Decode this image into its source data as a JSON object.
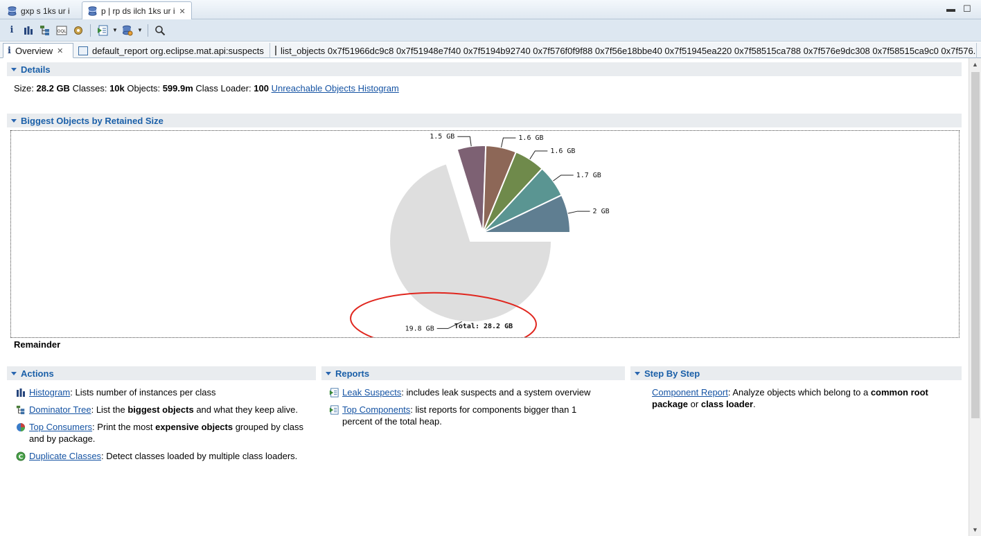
{
  "editor_tabs": [
    {
      "label": "gxp s 1ks ur i"
    },
    {
      "label": "p | rp ds ilch 1ks ur i"
    }
  ],
  "inner_tabs": {
    "overview": "Overview",
    "report": "default_report  org.eclipse.mat.api:suspects",
    "list_objects": "list_objects  0x7f51966dc9c8 0x7f51948e7f40 0x7f5194b92740 0x7f576f0f9f88 0x7f56e18bbe40 0x7f51945ea220 0x7f58515ca788 0x7f576e9dc308 0x7f58515ca9c0 0x7f576..."
  },
  "details": {
    "title": "Details",
    "size_label": "Size:",
    "size": "28.2 GB",
    "classes_label": "Classes:",
    "classes": "10k",
    "objects_label": "Objects:",
    "objects": "599.9m",
    "loader_label": "Class Loader:",
    "loader": "100",
    "histogram_link": "Unreachable Objects Histogram"
  },
  "biggest": {
    "title": "Biggest Objects by Retained Size",
    "remainder_label": "Remainder"
  },
  "chart_data": {
    "type": "pie",
    "total_label": "Total: 28.2 GB",
    "slices": [
      {
        "label": "1.5 GB",
        "value": 1.5,
        "color": "#7d6173"
      },
      {
        "label": "1.6 GB",
        "value": 1.6,
        "color": "#8d6757"
      },
      {
        "label": "1.6 GB",
        "value": 1.6,
        "color": "#6f8a4b"
      },
      {
        "label": "1.7 GB",
        "value": 1.7,
        "color": "#5a9592"
      },
      {
        "label": "2 GB",
        "value": 2.0,
        "color": "#5f7e91"
      },
      {
        "label": "19.8 GB",
        "value": 19.8,
        "color": "#dedede"
      }
    ]
  },
  "actions": {
    "title": "Actions",
    "items": [
      {
        "link": "Histogram",
        "pre": ": Lists number of instances per class",
        "bold": "",
        "post": ""
      },
      {
        "link": "Dominator Tree",
        "pre": ": List the ",
        "bold": "biggest objects",
        "post": " and what they keep alive."
      },
      {
        "link": "Top Consumers",
        "pre": ": Print the most ",
        "bold": "expensive objects",
        "post": " grouped by class and by package."
      },
      {
        "link": "Duplicate Classes",
        "pre": ": Detect classes loaded by multiple class loaders.",
        "bold": "",
        "post": ""
      }
    ]
  },
  "reports": {
    "title": "Reports",
    "items": [
      {
        "link": "Leak Suspects",
        "pre": ": includes leak suspects and a system overview",
        "bold": "",
        "post": ""
      },
      {
        "link": "Top Components",
        "pre": ": list reports for components bigger than 1 percent of the total heap.",
        "bold": "",
        "post": ""
      }
    ]
  },
  "stepbystep": {
    "title": "Step By Step",
    "link": "Component Report",
    "pre": ": Analyze objects which belong to a ",
    "bold1": "common root package",
    "mid": " or ",
    "bold2": "class loader",
    "post": "."
  }
}
